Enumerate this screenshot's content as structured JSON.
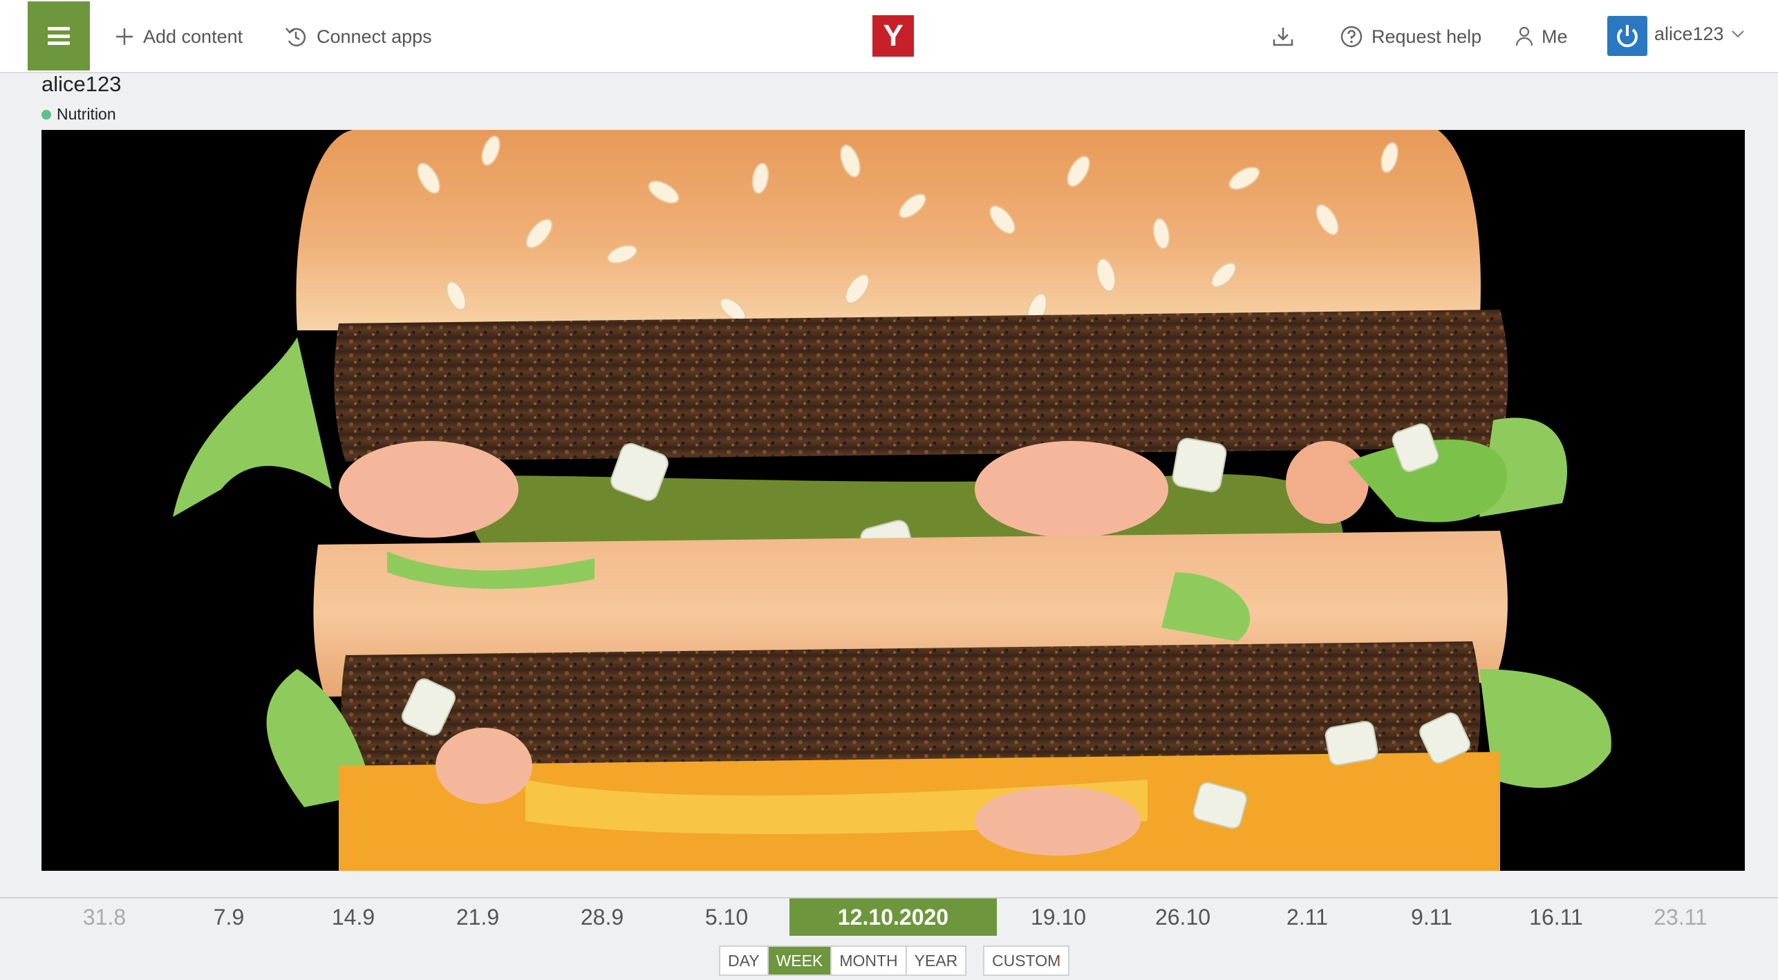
{
  "topbar": {
    "add_content": "Add content",
    "connect_apps": "Connect apps",
    "logo": "Y",
    "request_help": "Request help",
    "me": "Me",
    "username": "alice123"
  },
  "page": {
    "title": "alice123",
    "category": "Nutrition"
  },
  "colors": {
    "accent": "#6e963c",
    "logo": "#c8202a",
    "category_dot": "#5cc08a",
    "avatar": "#2a78c2"
  },
  "timeline": {
    "dates": [
      "31.8",
      "7.9",
      "14.9",
      "21.9",
      "28.9",
      "5.10",
      "12.10.2020",
      "19.10",
      "26.10",
      "2.11",
      "9.11",
      "16.11",
      "23.11"
    ],
    "active": "12.10.2020"
  },
  "range": {
    "options": [
      "DAY",
      "WEEK",
      "MONTH",
      "YEAR"
    ],
    "active": "WEEK",
    "custom": "CUSTOM"
  },
  "icons": [
    "menu-icon",
    "plus-icon",
    "connect-icon",
    "download-icon",
    "help-icon",
    "person-icon",
    "power-icon",
    "chevron-down-icon"
  ]
}
